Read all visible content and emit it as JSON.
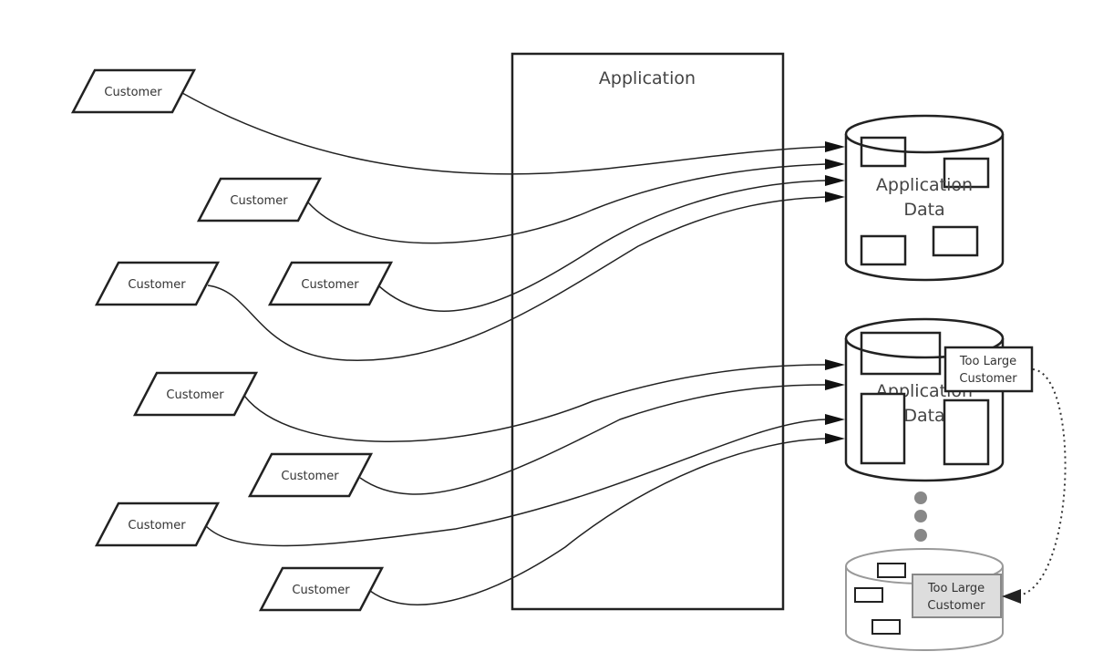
{
  "application": {
    "label": "Application"
  },
  "customers": [
    "Customer",
    "Customer",
    "Customer",
    "Customer",
    "Customer",
    "Customer",
    "Customer",
    "Customer"
  ],
  "databases": [
    {
      "label_line1": "Application",
      "label_line2": "Data"
    },
    {
      "label_line1": "Application",
      "label_line2": "Data",
      "callout_line1": "Too Large",
      "callout_line2": "Customer"
    },
    {
      "callout_line1": "Too Large",
      "callout_line2": "Customer"
    }
  ],
  "colors": {
    "line": "#222222",
    "faded": "#999999",
    "highlight_fill": "#dddddd",
    "dots": "#888888"
  }
}
